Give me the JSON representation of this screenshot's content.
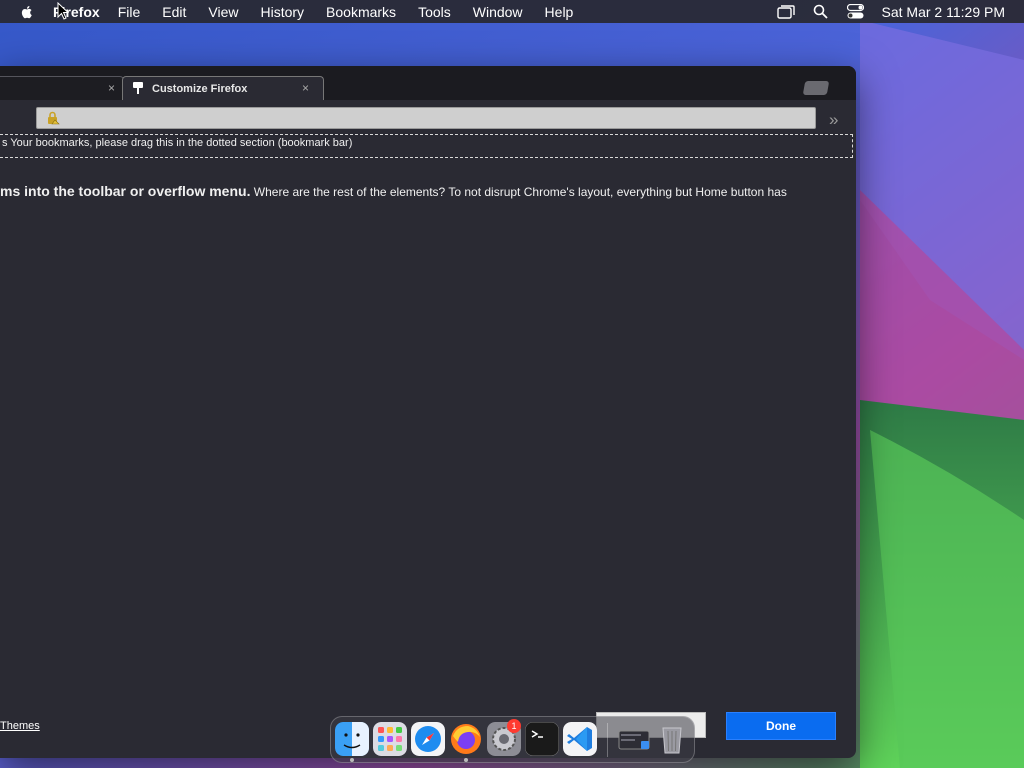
{
  "menubar": {
    "app_name": "Firefox",
    "items": [
      "File",
      "Edit",
      "View",
      "History",
      "Bookmarks",
      "Tools",
      "Window",
      "Help"
    ],
    "clock": "Sat Mar 2  11:29 PM"
  },
  "browser": {
    "active_tab": {
      "label": "Customize Firefox",
      "close": "×"
    },
    "inactive_tab": {
      "close": "×"
    },
    "overflow_chevron": "»",
    "bookmark_bar_text": "s  Your bookmarks, please drag this in the dotted section (bookmark bar)",
    "content_bold": "ms into the toolbar or overflow menu.",
    "content_text": " Where are the rest of the elements? To not disrupt Chrome's layout, everything but Home button has",
    "themes_link": "Themes",
    "done_button": "Done"
  },
  "dock": {
    "items": [
      "finder-icon",
      "launchpad-icon",
      "safari-icon",
      "firefox-icon",
      "system-settings-icon",
      "terminal-icon",
      "vscode-icon",
      "screenshot-thumbnail-icon",
      "trash-icon"
    ],
    "settings_badge": "1"
  },
  "colors": {
    "accent": "#0a6cf0",
    "window_bg": "#2a2a33",
    "menubar_bg": "#28282f"
  }
}
